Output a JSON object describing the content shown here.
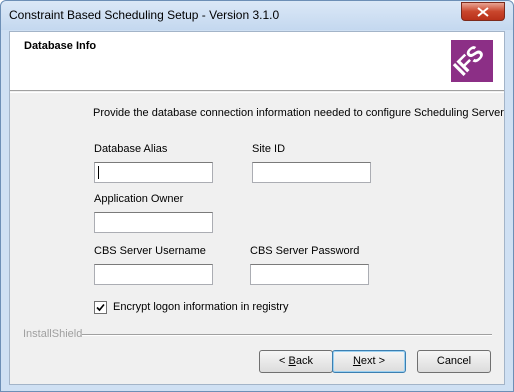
{
  "window": {
    "title": "Constraint Based Scheduling Setup - Version 3.1.0"
  },
  "header": {
    "title": "Database Info",
    "logo_text": "IFS",
    "logo_color": "#8c2f86"
  },
  "main": {
    "instruction": "Provide the database connection information needed to configure Scheduling Server",
    "fields": {
      "database_alias": {
        "label": "Database Alias",
        "value": ""
      },
      "site_id": {
        "label": "Site ID",
        "value": ""
      },
      "application_owner": {
        "label": "Application Owner",
        "value": ""
      },
      "cbs_username": {
        "label": "CBS Server Username",
        "value": ""
      },
      "cbs_password": {
        "label": "CBS Server Password",
        "value": ""
      }
    },
    "encrypt_checkbox": {
      "label": "Encrypt logon information in registry",
      "checked": true
    }
  },
  "footer": {
    "brand": "InstallShield",
    "back_prefix": "< ",
    "back_key": "B",
    "back_rest": "ack",
    "next_key": "N",
    "next_rest": "ext >",
    "cancel": "Cancel"
  }
}
